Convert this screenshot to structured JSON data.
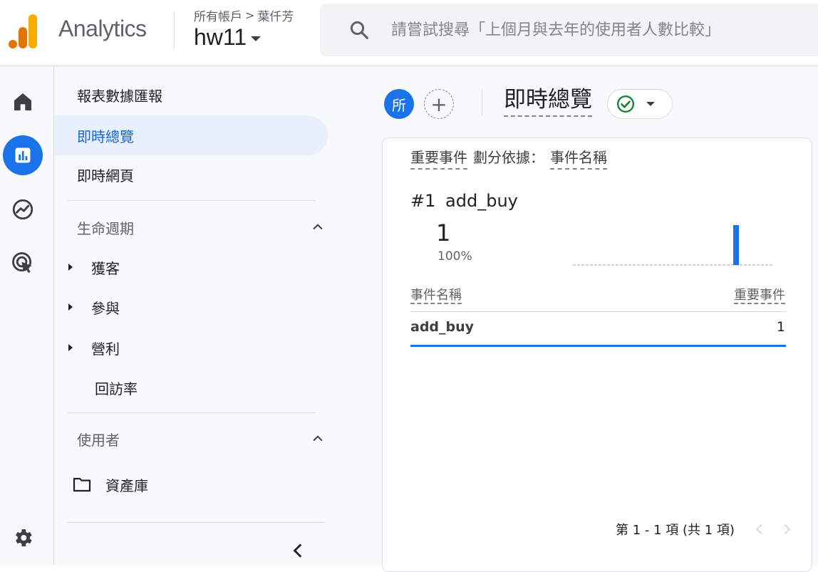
{
  "header": {
    "brand": "Analytics",
    "breadcrumb": {
      "account": "所有帳戶",
      "separator": ">",
      "user": "葉仟芳"
    },
    "property": "hw11",
    "search_placeholder": "請嘗試搜尋「上個月與去年的使用者人數比較」"
  },
  "rail": {
    "icons": [
      "home-icon",
      "reports-icon",
      "explore-icon",
      "advertising-icon",
      "settings-icon"
    ],
    "active": "reports-icon",
    "accent": "#1a73e8"
  },
  "nav": {
    "items": [
      {
        "label": "報表數據匯報"
      },
      {
        "label": "即時總覽"
      },
      {
        "label": "即時網頁"
      }
    ],
    "lifecycle": {
      "title": "生命週期",
      "children": [
        "獲客",
        "參與",
        "營利",
        "回訪率"
      ]
    },
    "user": {
      "title": "使用者",
      "library": "資產庫"
    }
  },
  "main": {
    "comparison_chip": "所",
    "add_chip": "+",
    "title": "即時總覽",
    "card": {
      "metric_label": "重要事件",
      "split_label": "劃分依據：",
      "dimension_label": "事件名稱",
      "rank": "#1",
      "top_event": "add_buy",
      "top_value": "1",
      "top_percent": "100%",
      "table": {
        "col_event": "事件名稱",
        "col_key_events": "重要事件",
        "rows": [
          {
            "event": "add_buy",
            "value": "1"
          }
        ]
      },
      "pagination": "第 1 - 1 項 (共 1 項)"
    }
  }
}
